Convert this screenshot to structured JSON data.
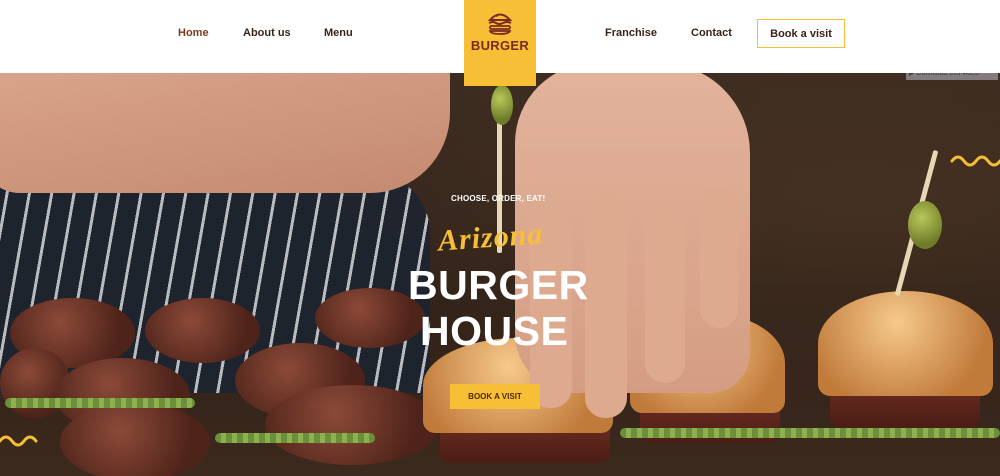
{
  "nav": {
    "left": [
      "Home",
      "About us",
      "Menu"
    ],
    "right": [
      "Franchise",
      "Contact"
    ],
    "book_label": "Book a visit"
  },
  "logo": {
    "text": "BURGER",
    "icon": "burger-icon"
  },
  "video": {
    "label": "▶ Download this video"
  },
  "hero": {
    "eyebrow": "CHOOSE, ORDER, EAT!",
    "script_title": "Arizona",
    "title_line1": "BURGER",
    "title_line2": "HOUSE",
    "cta_label": "BOOK A VISIT"
  },
  "colors": {
    "accent": "#f7bf35",
    "brand_dark": "#7a2a1e",
    "text_dark": "#3a2418"
  }
}
